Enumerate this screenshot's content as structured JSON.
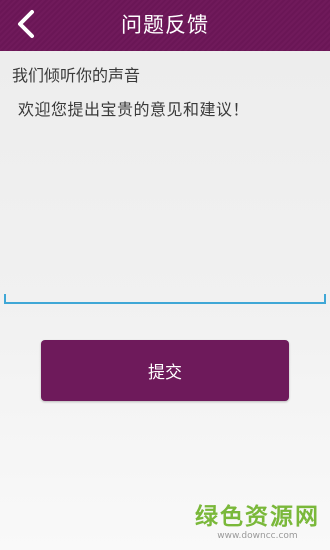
{
  "header": {
    "title": "问题反馈",
    "back_icon": "chevron-left-icon",
    "background": "#6a1656"
  },
  "feedback": {
    "subtitle": "我们倾听你的声音",
    "placeholder": "欢迎您提出宝贵的意见和建议！",
    "value": "",
    "accent_color": "#3fa7d6"
  },
  "actions": {
    "submit_label": "提交",
    "submit_color": "#6e1a5b"
  },
  "watermark": {
    "main": "绿色资源网",
    "sub": "www.downcc.com"
  }
}
